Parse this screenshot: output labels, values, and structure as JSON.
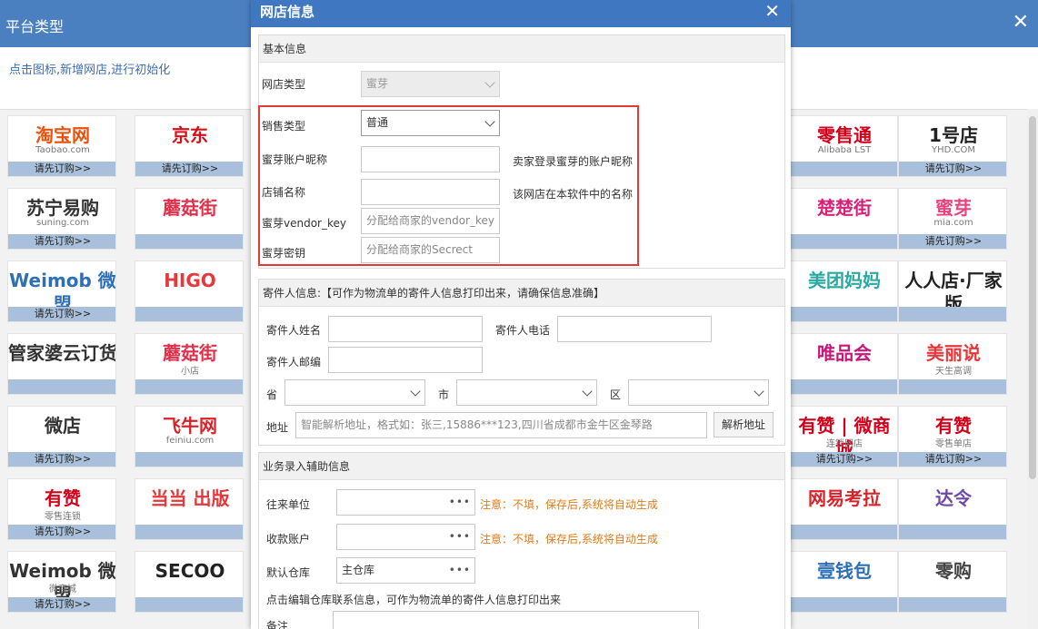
{
  "background": {
    "title": "平台类型",
    "hint": "点击图标,新增网店,进行初始化",
    "tiles": [
      {
        "name": "taobao",
        "logo": "淘宝网",
        "sub": "Taobao.com",
        "bar": "请先订购>>",
        "color": "#e8520c"
      },
      {
        "name": "jd",
        "logo": "京东",
        "sub": "",
        "bar": "请先订购>>",
        "color": "#d5121b"
      },
      {
        "name": "suning",
        "logo": "苏宁易购",
        "sub": "suning.com",
        "bar": "请先订购>>",
        "color": "#333333"
      },
      {
        "name": "mogujie",
        "logo": "蘑菇街",
        "sub": "",
        "bar": "",
        "color": "#e0304a"
      },
      {
        "name": "weimob",
        "logo": "Weimob 微盟",
        "sub": "",
        "bar": "请先订购>>",
        "color": "#2e6fb5"
      },
      {
        "name": "higo",
        "logo": "HIGO",
        "sub": "",
        "bar": "",
        "color": "#e43a3e"
      },
      {
        "name": "guanjiapo",
        "logo": "管家婆云订货",
        "sub": "",
        "bar": "",
        "color": "#333333"
      },
      {
        "name": "mogujie-xiaodian",
        "logo": "蘑菇街",
        "sub": "小店",
        "bar": "",
        "color": "#e0304a"
      },
      {
        "name": "weidian",
        "logo": "微店",
        "sub": "",
        "bar": "请先订购>>",
        "color": "#333333"
      },
      {
        "name": "feiniu",
        "logo": "飞牛网",
        "sub": "feiniu.com",
        "bar": "",
        "color": "#d8232a"
      },
      {
        "name": "youzan-retail-chain",
        "logo": "有赞",
        "sub": "零售连锁",
        "bar": "请先订购>>",
        "color": "#d0021b"
      },
      {
        "name": "dangdang",
        "logo": "当当 出版",
        "sub": "",
        "bar": "",
        "color": "#e4393c"
      },
      {
        "name": "weimob-weishangcheng",
        "logo": "Weimob 微盟",
        "sub": "微商城",
        "bar": "请先订购>>",
        "color": "#333333"
      },
      {
        "name": "secoo",
        "logo": "SECOO",
        "sub": "",
        "bar": "",
        "color": "#222222"
      },
      {
        "name": "alibaba-lst",
        "logo": "零售通",
        "sub": "Alibaba LST",
        "bar": "",
        "color": "#d0021b"
      },
      {
        "name": "yhd",
        "logo": "1号店",
        "sub": "YHD.COM",
        "bar": "请先订购>>",
        "color": "#222222"
      },
      {
        "name": "chuchujie",
        "logo": "楚楚街",
        "sub": "",
        "bar": "",
        "color": "#d6237a"
      },
      {
        "name": "mia",
        "logo": "蜜芽",
        "sub": "mia.com",
        "bar": "请先订购>>",
        "color": "#e8457f"
      },
      {
        "name": "meituanmama",
        "logo": "美团妈妈",
        "sub": "",
        "bar": "",
        "color": "#2aa9a0"
      },
      {
        "name": "renrendian",
        "logo": "人人店·厂家版",
        "sub": "",
        "bar": "",
        "color": "#222222"
      },
      {
        "name": "vip",
        "logo": "唯品会",
        "sub": "",
        "bar": "",
        "color": "#c4187a"
      },
      {
        "name": "meilishuo",
        "logo": "美丽说",
        "sub": "天生高调",
        "bar": "",
        "color": "#e4393c"
      },
      {
        "name": "youzan-weishangcheng",
        "logo": "有赞 | 微商城",
        "sub": "连锁网店",
        "bar": "请先订购>>",
        "color": "#d0021b"
      },
      {
        "name": "youzan-retail-single",
        "logo": "有赞",
        "sub": "零售单店",
        "bar": "请先订购>>",
        "color": "#d0021b"
      },
      {
        "name": "wangyi-kaola",
        "logo": "网易考拉",
        "sub": "",
        "bar": "",
        "color": "#d8232a"
      },
      {
        "name": "dalin",
        "logo": "达令",
        "sub": "",
        "bar": "",
        "color": "#6d4aa8"
      },
      {
        "name": "yiqianbao",
        "logo": "壹钱包",
        "sub": "",
        "bar": "",
        "color": "#2e6fb5"
      },
      {
        "name": "linggou",
        "logo": "零购",
        "sub": "",
        "bar": "",
        "color": "#444444"
      }
    ]
  },
  "modal": {
    "title": "网店信息",
    "basic": {
      "header": "基本信息",
      "shop_type_label": "网店类型",
      "shop_type_value": "蜜芽",
      "sale_type_label": "销售类型",
      "sale_type_value": "普通",
      "account_label": "蜜芽账户昵称",
      "account_value": "",
      "account_hint": "卖家登录蜜芽的账户昵称",
      "store_name_label": "店铺名称",
      "store_name_value": "",
      "store_name_hint": "该网店在本软件中的名称",
      "vendor_key_label": "蜜芽vendor_key",
      "vendor_key_placeholder": "分配给商家的vendor_key",
      "secret_label": "蜜芽密钥",
      "secret_placeholder": "分配给商家的Secrect"
    },
    "sender": {
      "header": "寄件人信息:【可作为物流单的寄件人信息打印出来，请确保信息准确】",
      "name_label": "寄件人姓名",
      "phone_label": "寄件人电话",
      "email_label": "寄件人邮编",
      "province_label": "省",
      "city_label": "市",
      "district_label": "区",
      "address_label": "地址",
      "address_placeholder": "智能解析地址，格式如：张三,15886***123,四川省成都市金牛区金琴路",
      "parse_button": "解析地址"
    },
    "business": {
      "header": "业务录入辅助信息",
      "partner_label": "往来单位",
      "partner_warn": "注意：不填，保存后,系统将自动生成",
      "account_label": "收款账户",
      "account_warn": "注意：不填，保存后,系统将自动生成",
      "warehouse_label": "默认仓库",
      "warehouse_value": "主仓库",
      "warehouse_note": "点击编辑仓库联系信息，可作为物流单的寄件人信息打印出来",
      "remark_label": "备注"
    }
  }
}
